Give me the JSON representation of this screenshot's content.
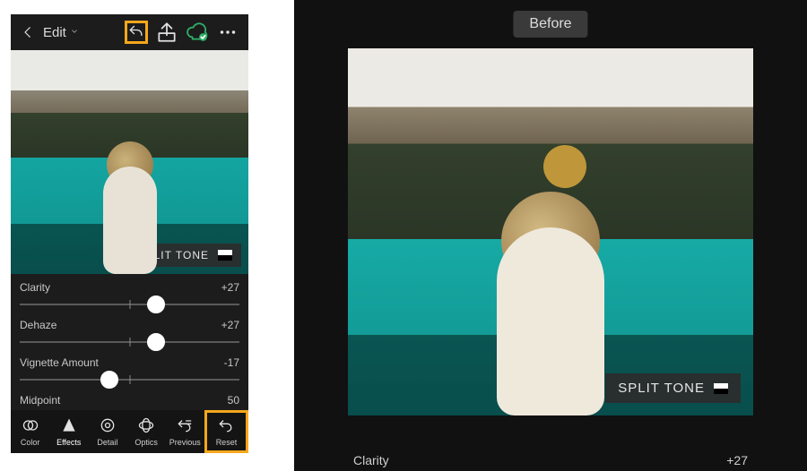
{
  "left": {
    "header": {
      "edit_label": "Edit"
    },
    "split_tone_label": "SPLIT TONE",
    "sliders": [
      {
        "name": "Clarity",
        "value": "+27",
        "pos": 62,
        "center": 50
      },
      {
        "name": "Dehaze",
        "value": "+27",
        "pos": 62,
        "center": 50
      },
      {
        "name": "Vignette Amount",
        "value": "-17",
        "pos": 41,
        "center": 50
      },
      {
        "name": "Midpoint",
        "value": "50",
        "pos": 50,
        "center": 50
      }
    ],
    "toolbar": [
      {
        "label": "Color",
        "icon": "color"
      },
      {
        "label": "Effects",
        "icon": "effects"
      },
      {
        "label": "Detail",
        "icon": "detail"
      },
      {
        "label": "Optics",
        "icon": "optics"
      },
      {
        "label": "Previous",
        "icon": "previous"
      },
      {
        "label": "Reset",
        "icon": "reset"
      }
    ],
    "toolbar_selected_index": 1,
    "toolbar_highlight_index": 5,
    "topbar_highlight_undo": true
  },
  "right": {
    "before_label": "Before",
    "split_tone_label": "SPLIT TONE",
    "clarity_label": "Clarity",
    "clarity_value": "+27"
  }
}
